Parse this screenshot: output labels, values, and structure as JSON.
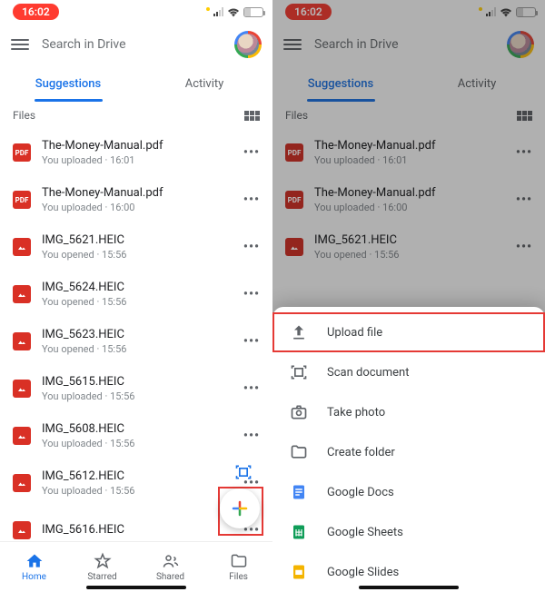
{
  "status": {
    "time": "16:02"
  },
  "search": {
    "placeholder": "Search in Drive"
  },
  "tabs": {
    "suggestions": "Suggestions",
    "activity": "Activity"
  },
  "section": {
    "label": "Files"
  },
  "files": [
    {
      "name": "The-Money-Manual.pdf",
      "meta": "You uploaded · 16:01",
      "type": "pdf"
    },
    {
      "name": "The-Money-Manual.pdf",
      "meta": "You uploaded · 16:00",
      "type": "pdf"
    },
    {
      "name": "IMG_5621.HEIC",
      "meta": "You opened · 15:56",
      "type": "img"
    },
    {
      "name": "IMG_5624.HEIC",
      "meta": "You opened · 15:56",
      "type": "img"
    },
    {
      "name": "IMG_5623.HEIC",
      "meta": "You opened · 15:56",
      "type": "img"
    },
    {
      "name": "IMG_5615.HEIC",
      "meta": "You uploaded · 15:56",
      "type": "img"
    },
    {
      "name": "IMG_5608.HEIC",
      "meta": "You uploaded · 15:56",
      "type": "img"
    },
    {
      "name": "IMG_5612.HEIC",
      "meta": "You uploaded · 15:56",
      "type": "img"
    },
    {
      "name": "IMG_5616.HEIC",
      "meta": "",
      "type": "img"
    }
  ],
  "files_short": [
    {
      "name": "The-Money-Manual.pdf",
      "meta": "You uploaded · 16:01",
      "type": "pdf"
    },
    {
      "name": "The-Money-Manual.pdf",
      "meta": "You uploaded · 16:00",
      "type": "pdf"
    },
    {
      "name": "IMG_5621.HEIC",
      "meta": "You opened · 15:56",
      "type": "img"
    }
  ],
  "bottomnav": {
    "home": "Home",
    "starred": "Starred",
    "shared": "Shared",
    "files": "Files"
  },
  "sheet": {
    "upload": "Upload file",
    "scan": "Scan document",
    "photo": "Take photo",
    "folder": "Create folder",
    "docs": "Google Docs",
    "sheets": "Google Sheets",
    "slides": "Google Slides"
  }
}
